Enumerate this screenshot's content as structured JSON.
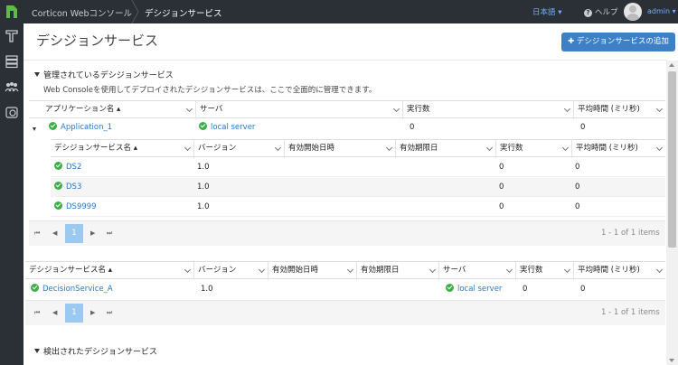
{
  "header": {
    "app_title": "Corticon Webコンソール",
    "breadcrumb_current": "デシジョンサービス",
    "language": "日本語 ▾",
    "help": "ヘルプ",
    "user": "admin ▾"
  },
  "page": {
    "title": "デシジョンサービス",
    "add_button": "✚ デシジョンサービスの追加"
  },
  "managed": {
    "title": "管理されているデシジョンサービス",
    "description": "Web Consoleを使用してデプロイされたデシジョンサービスは、ここで全面的に管理できます。",
    "columns": [
      "アプリケーション名 ▴",
      "サーバ",
      "実行数",
      "平均時間 (ミリ秒)"
    ],
    "app_row": {
      "name": "Application_1",
      "server": "local server",
      "executions": "0",
      "avg_time": "0"
    },
    "nested": {
      "columns": [
        "デシジョンサービス名 ▴",
        "バージョン",
        "有効開始日時",
        "有効期限日",
        "実行数",
        "平均時間 (ミリ秒)"
      ],
      "rows": [
        {
          "name": "DS2",
          "version": "1.0",
          "start": "",
          "end": "",
          "executions": "0",
          "avg_time": "0"
        },
        {
          "name": "DS3",
          "version": "1.0",
          "start": "",
          "end": "",
          "executions": "0",
          "avg_time": "0"
        },
        {
          "name": "DS9999",
          "version": "1.0",
          "start": "",
          "end": "",
          "executions": "0",
          "avg_time": "0"
        }
      ],
      "pager": {
        "page": "1",
        "info": "1 - 1 of 1 items"
      }
    }
  },
  "standalone": {
    "columns": [
      "デシジョンサービス名 ▴",
      "バージョン",
      "有効開始日時",
      "有効期限日",
      "サーバ",
      "実行数",
      "平均時間 (ミリ秒)"
    ],
    "rows": [
      {
        "name": "DecisionService_A",
        "version": "1.0",
        "start": "",
        "end": "",
        "server": "local server",
        "executions": "0",
        "avg_time": "0"
      }
    ],
    "pager": {
      "page": "1",
      "info": "1 - 1 of 1 items"
    }
  },
  "discovered": {
    "title": "検出されたデシジョンサービス"
  },
  "icons": {
    "logo": "corticon-logo-icon",
    "nav": [
      "rules-icon",
      "server-stack-icon",
      "users-icon",
      "history-icon"
    ]
  },
  "colors": {
    "topbar": "#2b2f36",
    "accent": "#3d80c6",
    "link": "#2a78c8",
    "status_ok": "#3fae49"
  }
}
